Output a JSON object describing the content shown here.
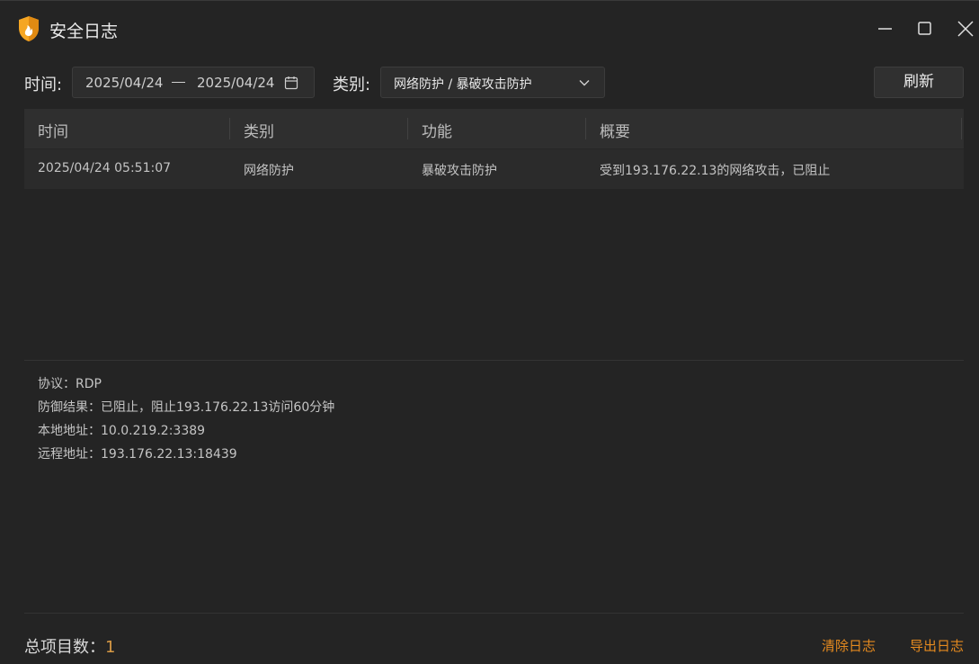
{
  "window": {
    "title": "安全日志",
    "app_icon": "shield-flame-icon",
    "controls": [
      "minimize-icon",
      "maximize-icon",
      "close-icon"
    ]
  },
  "toolbar": {
    "time_label": "时间:",
    "date_start": "2025/04/24",
    "date_end": "2025/04/24",
    "category_label": "类别:",
    "category_value": "网络防护 / 暴破攻击防护",
    "refresh_label": "刷新"
  },
  "table": {
    "columns": [
      "时间",
      "类别",
      "功能",
      "概要"
    ],
    "rows": [
      {
        "time": "2025/04/24 05:51:07",
        "category": "网络防护",
        "feature": "暴破攻击防护",
        "summary": "受到193.176.22.13的网络攻击，已阻止"
      }
    ]
  },
  "details": {
    "protocol": "协议：RDP",
    "result": "防御结果：已阻止，阻止193.176.22.13访问60分钟",
    "local": "本地地址：10.0.219.2:3389",
    "remote": "远程地址：193.176.22.13:18439"
  },
  "footer": {
    "total_label": "总项目数：",
    "total_count": "1",
    "clear_label": "清除日志",
    "export_label": "导出日志"
  },
  "colors": {
    "background": "#242424",
    "accent": "#e58a1f",
    "shield": "#f5a623"
  }
}
